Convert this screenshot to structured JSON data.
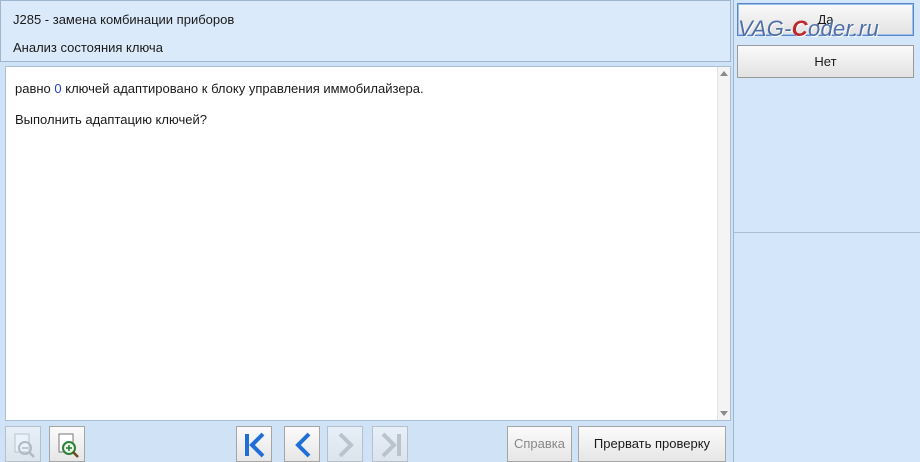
{
  "header": {
    "title": "J285 - замена комбинации приборов",
    "subtitle": "Анализ состояния ключа"
  },
  "content": {
    "line1_prefix": "равно ",
    "line1_number": "0",
    "line1_suffix": " ключей адаптировано к блоку управления иммобилайзера.",
    "line2": "Выполнить адаптацию ключей?"
  },
  "right_panel": {
    "yes_label": "Да",
    "no_label": "Нет"
  },
  "watermark": {
    "prefix": "VAG-",
    "highlight": "C",
    "suffix": "oder.ru"
  },
  "toolbar": {
    "help_label": "Справка",
    "abort_label": "Прервать проверку"
  },
  "colors": {
    "accent_blue": "#1f6fd6",
    "number_blue": "#1f3fd6",
    "panel_bg": "#d4e6fa"
  },
  "icons": [
    "zoom-out-icon",
    "zoom-in-icon",
    "first-page-icon",
    "previous-icon",
    "next-icon",
    "last-page-icon"
  ]
}
